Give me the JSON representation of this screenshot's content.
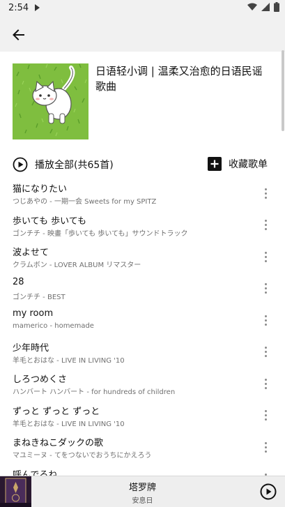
{
  "status_bar": {
    "time": "2:54"
  },
  "playlist": {
    "title": "日语轻小调 | 温柔又治愈的日语民谣歌曲",
    "play_all_label": "播放全部(共65首)",
    "collect_label": "收藏歌单"
  },
  "songs": [
    {
      "title": "猫になりたい",
      "subtitle": "つじあやの - 一期一会 Sweets for my SPITZ"
    },
    {
      "title": "歩いても 歩いても",
      "subtitle": "ゴンチチ - 映畫「歩いても 歩いても」サウンドトラック"
    },
    {
      "title": "波よせて",
      "subtitle": "クラムボン - LOVER ALBUM リマスター"
    },
    {
      "title": "28",
      "subtitle": "ゴンチチ - BEST"
    },
    {
      "title": "my room",
      "subtitle": "mamerico - homemade"
    },
    {
      "title": "少年時代",
      "subtitle": "羊毛とおはな - LIVE IN LIVING '10"
    },
    {
      "title": "しろつめくさ",
      "subtitle": "ハンバート ハンバート - for hundreds of children"
    },
    {
      "title": "ずっと ずっと ずっと",
      "subtitle": "羊毛とおはな - LIVE IN LIVING '10"
    },
    {
      "title": "まねきねこダックの歌",
      "subtitle": "マユミーヌ - てをつないでおうちにかえろう"
    },
    {
      "title": "呼んでるね",
      "subtitle": ""
    }
  ],
  "player": {
    "title": "塔罗牌",
    "artist": "安息日"
  },
  "icons": {
    "back": "arrow-left-icon",
    "play_all": "play-circle-icon",
    "collect": "add-box-icon",
    "more": "more-vertical-icon",
    "player_play": "play-circle-icon"
  },
  "colors": {
    "background": "#ffffff",
    "app_bar": "#f1f1f1",
    "player_bar": "#eeeeee"
  }
}
